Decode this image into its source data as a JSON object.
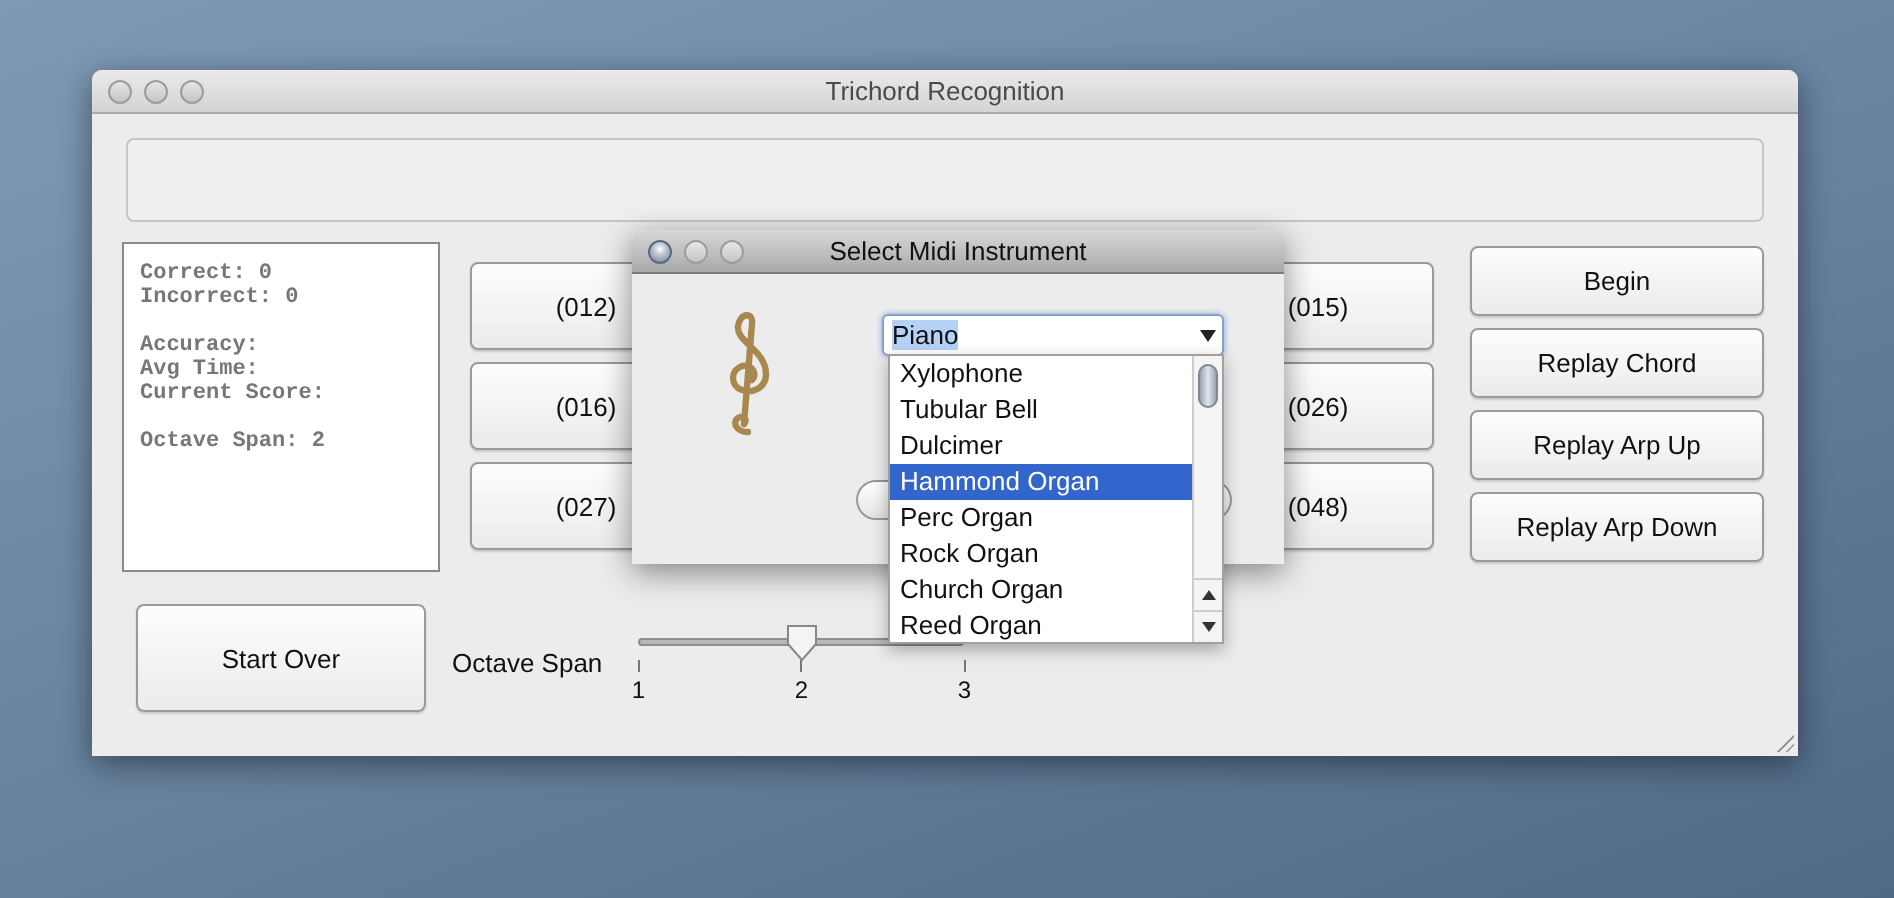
{
  "main_window": {
    "title": "Trichord Recognition",
    "stats": [
      {
        "lines": [
          "Correct: 0",
          "Incorrect: 0"
        ]
      },
      {
        "lines": [
          "Accuracy:",
          "Avg Time:",
          "Current Score:"
        ]
      },
      {
        "lines": [
          "Octave Span: 2"
        ]
      }
    ],
    "chords_left": [
      "(012)",
      "(016)",
      "(027)"
    ],
    "chords_right": [
      "(015)",
      "(026)",
      "(048)"
    ],
    "action_buttons": [
      "Begin",
      "Replay Chord",
      "Replay Arp Up",
      "Replay Arp Down"
    ],
    "start_over": "Start Over",
    "octave_slider": {
      "label": "Octave Span",
      "level": 0.5,
      "ticks": [
        "1",
        "2",
        "3"
      ]
    }
  },
  "dialog": {
    "title": "Select Midi Instrument",
    "combo": {
      "value": "Piano"
    },
    "list": [
      {
        "label": "Xylophone",
        "selected": false
      },
      {
        "label": "Tubular Bell",
        "selected": false
      },
      {
        "label": "Dulcimer",
        "selected": false
      },
      {
        "label": "Hammond Organ",
        "selected": true
      },
      {
        "label": "Perc Organ",
        "selected": false
      },
      {
        "label": "Rock Organ",
        "selected": false
      },
      {
        "label": "Church Organ",
        "selected": false
      },
      {
        "label": "Reed Organ",
        "selected": false
      }
    ]
  }
}
